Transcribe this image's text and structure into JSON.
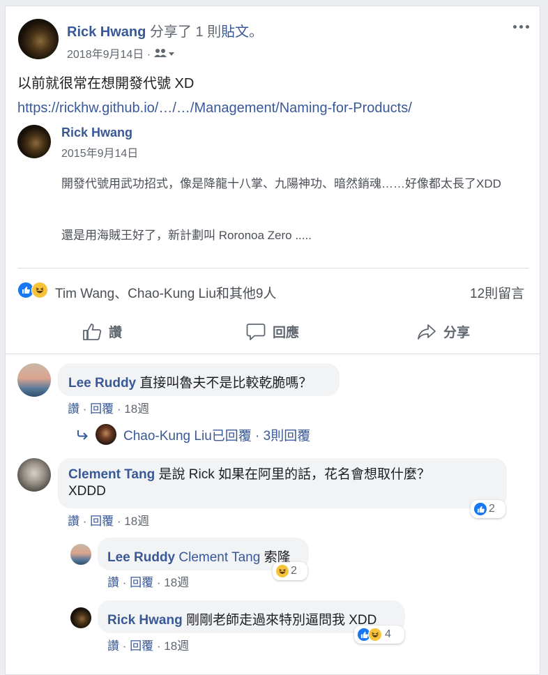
{
  "post": {
    "author": "Rick Hwang",
    "shared_text": "分享了 1 則",
    "shared_link": "貼文",
    "shared_end": "。",
    "date": "2018年9月14日 ·",
    "body": "以前就很常在想開發代號 XD",
    "url": "https://rickhw.github.io/…/…/Management/Naming-for-Products/",
    "more_icon": "more-dots-icon",
    "privacy_icon": "friends-icon"
  },
  "shared": {
    "author": "Rick Hwang",
    "date": "2015年9月14日",
    "para1": "開發代號用武功招式，像是降龍十八掌、九陽神功、暗然銷魂……好像都太長了XDD",
    "para2": "還是用海賊王好了，新計劃叫 Roronoa Zero ....."
  },
  "reactions": {
    "summary": "Tim Wang、Chao-Kung Liu和其他9人",
    "comments_count": "12則留言"
  },
  "actions": {
    "like": "讚",
    "comment": "回應",
    "share": "分享"
  },
  "comments": [
    {
      "author": "Lee Ruddy",
      "text": "直接叫魯夫不是比較乾脆嗎？",
      "like": "讚",
      "reply": "回覆",
      "time": "18週",
      "sep": "·"
    },
    {
      "author": "Clement Tang",
      "text": "是說 Rick 如果在阿里的話，花名會想取什麼？",
      "text2": "XDDD",
      "like": "讚",
      "reply": "回覆",
      "time": "18週",
      "reaction_count": "2"
    }
  ],
  "reply_summary": {
    "text": "Chao-Kung Liu已回覆 · 3則回覆"
  },
  "replies": [
    {
      "author": "Lee Ruddy",
      "mention": "Clement Tang",
      "text": "索隆",
      "like": "讚",
      "reply": "回覆",
      "time": "18週",
      "reaction_count": "2"
    },
    {
      "author": "Rick Hwang",
      "text": "剛剛老師走過來特別逼問我 XDD",
      "like": "讚",
      "reply": "回覆",
      "time": "18週",
      "reaction_count": "4"
    }
  ],
  "colors": {
    "link": "#385898",
    "like_blue": "#1877f2",
    "haha_yellow": "#f7c33b",
    "bubble_bg": "#f2f3f5"
  }
}
